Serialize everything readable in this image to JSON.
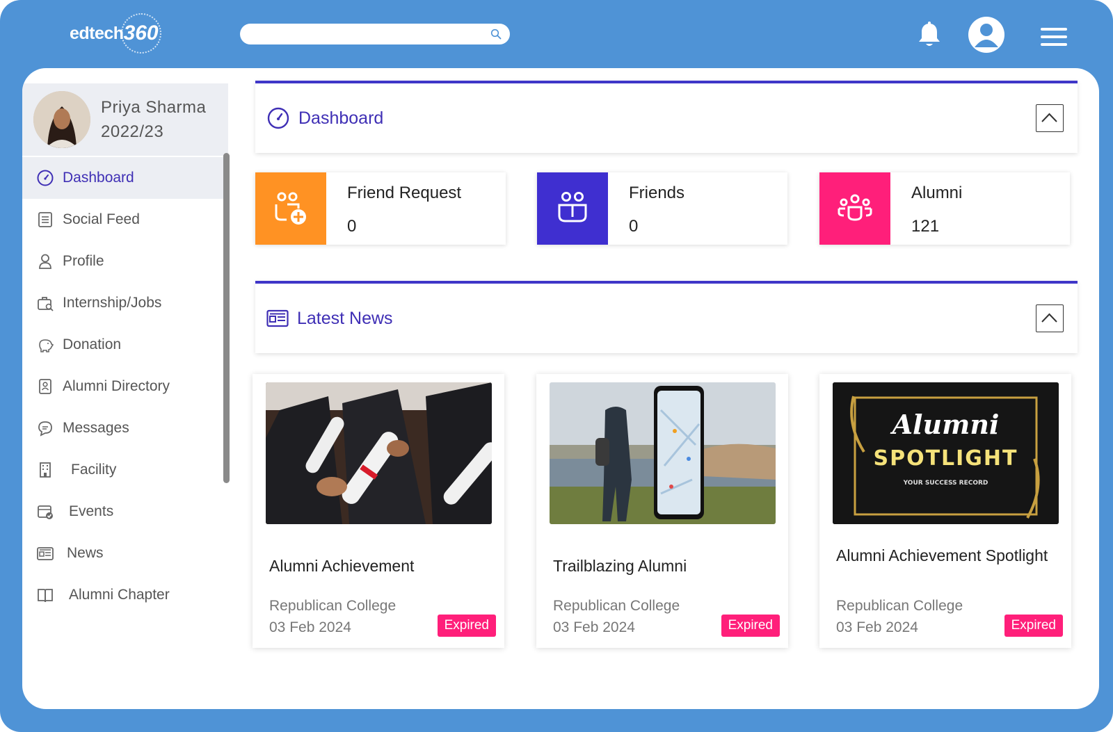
{
  "header": {
    "logo_text": "edtech",
    "logo_number": "360",
    "search_placeholder": ""
  },
  "user": {
    "name": "Priya Sharma",
    "year": "2022/23"
  },
  "sidebar": {
    "items": [
      {
        "label": "Dashboard",
        "icon": "dashboard-gauge-icon",
        "active": true
      },
      {
        "label": "Social Feed",
        "icon": "document-list-icon"
      },
      {
        "label": "Profile",
        "icon": "user-icon"
      },
      {
        "label": "Internship/Jobs",
        "icon": "briefcase-search-icon"
      },
      {
        "label": "Donation",
        "icon": "piggy-bank-icon"
      },
      {
        "label": "Alumni Directory",
        "icon": "contact-book-icon"
      },
      {
        "label": "Messages",
        "icon": "chat-bubble-icon"
      },
      {
        "label": "Facility",
        "icon": "building-icon"
      },
      {
        "label": "Events",
        "icon": "calendar-check-icon"
      },
      {
        "label": "News",
        "icon": "newspaper-icon"
      },
      {
        "label": "Alumni Chapter",
        "icon": "open-book-icon"
      }
    ]
  },
  "dashboard": {
    "title": "Dashboard",
    "stats": [
      {
        "label": "Friend Request",
        "value": "0",
        "color": "#ff9223"
      },
      {
        "label": "Friends",
        "value": "0",
        "color": "#3f2fd0"
      },
      {
        "label": "Alumni",
        "value": "121",
        "color": "#ff1f7a"
      }
    ]
  },
  "latest_news": {
    "title": "Latest News",
    "items": [
      {
        "title": "Alumni Achievement",
        "college": "Republican College",
        "date": "03 Feb 2024",
        "status": "Expired"
      },
      {
        "title": "Trailblazing Alumni",
        "college": "Republican College",
        "date": "03 Feb 2024",
        "status": "Expired"
      },
      {
        "title": "Alumni Achievement Spotlight",
        "college": "Republican College",
        "date": "03 Feb 2024",
        "status": "Expired",
        "image_script": "Alumni",
        "image_headline": "SPOTLIGHT",
        "image_caption": "YOUR SUCCESS RECORD"
      }
    ]
  },
  "colors": {
    "frame_blue": "#4f93d6",
    "accent_purple": "#3f2fb5",
    "expired_pink": "#ff1f7a"
  }
}
